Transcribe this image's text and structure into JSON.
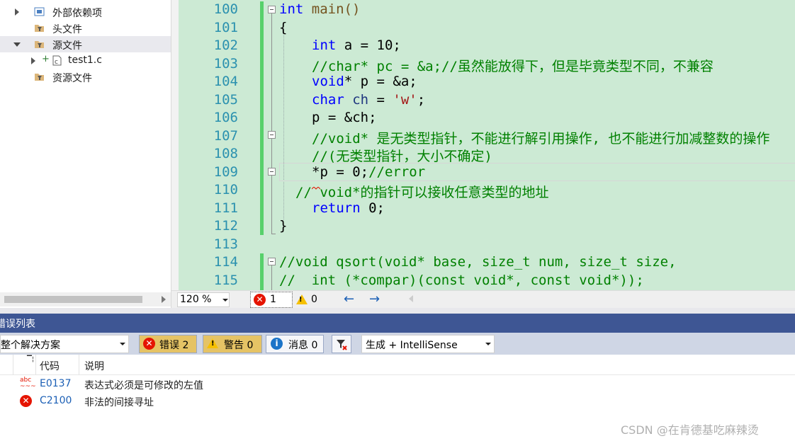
{
  "solution_explorer": {
    "items": [
      {
        "label": "外部依赖项",
        "icon": "external-deps-icon"
      },
      {
        "label": "头文件",
        "icon": "folder-filter-icon"
      },
      {
        "label": "源文件",
        "icon": "folder-filter-icon",
        "selected": true
      },
      {
        "label": "test1.c",
        "icon": "c-file-icon"
      },
      {
        "label": "资源文件",
        "icon": "folder-filter-icon"
      }
    ]
  },
  "editor": {
    "lines": [
      {
        "num": "100"
      },
      {
        "num": "101"
      },
      {
        "num": "102"
      },
      {
        "num": "103"
      },
      {
        "num": "104"
      },
      {
        "num": "105"
      },
      {
        "num": "106"
      },
      {
        "num": "107"
      },
      {
        "num": "108"
      },
      {
        "num": "109"
      },
      {
        "num": "110"
      },
      {
        "num": "111"
      },
      {
        "num": "112"
      },
      {
        "num": "113"
      },
      {
        "num": "114"
      },
      {
        "num": "115"
      }
    ],
    "code": {
      "l100_kw": "int",
      "l100_rest": " main()",
      "l101": "{",
      "l102_kw": "int",
      "l102_rest": " a = 10;",
      "l103": "//char* pc = &a;//虽然能放得下，但是毕竟类型不同，不兼容",
      "l104_kw": "void",
      "l104_rest": "* p = &a;",
      "l105_kw": "char",
      "l105_var": " ch",
      "l105_eq": " = ",
      "l105_str": "'w'",
      "l105_end": ";",
      "l106": "p = &ch;",
      "l107": "//void* 是无类型指针，不能进行解引用操作, 也不能进行加减整数的操作",
      "l108": "//(无类型指针，大小不确定)",
      "l109_code": "*p = 0;",
      "l109_cm": "//error",
      "l110": "// void*的指针可以接收任意类型的地址",
      "l111_kw": "return",
      "l111_rest": " 0;",
      "l112": "}",
      "l113": "",
      "l114": "//void qsort(void* base, size_t num, size_t size,",
      "l115": "//  int (*compar)(const void*, const void*));"
    }
  },
  "editor_status": {
    "zoom": "120 %",
    "errors": "1",
    "warnings": "0"
  },
  "error_list": {
    "title": "错误列表",
    "scope": "整个解决方案",
    "errors_btn": "错误 2",
    "warnings_btn": "警告 0",
    "messages_btn": "消息 0",
    "build_filter": "生成 + IntelliSense",
    "columns": {
      "code": "代码",
      "description": "说明"
    },
    "rows": [
      {
        "code": "E0137",
        "description": "表达式必须是可修改的左值",
        "icon": "abc-squiggle-icon"
      },
      {
        "code": "C2100",
        "description": "非法的间接寻址",
        "icon": "error-icon"
      }
    ]
  },
  "watermark": "CSDN @在肯德基吃麻辣烫"
}
